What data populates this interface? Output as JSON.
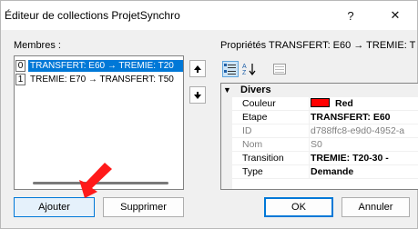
{
  "window": {
    "title": "Éditeur de collections ProjetSynchro",
    "help_glyph": "?",
    "close_glyph": "✕"
  },
  "members": {
    "label": "Membres :",
    "items": [
      {
        "index": "0",
        "text": "TRANSFERT: E60 → TREMIE: T20",
        "selected": true
      },
      {
        "index": "1",
        "text": "TREMIE: E70 → TRANSFERT: T50",
        "selected": false
      }
    ]
  },
  "properties": {
    "label": "Propriétés TRANSFERT: E60 → TREMIE: T",
    "category": "Divers",
    "rows": [
      {
        "name": "Couleur",
        "value": "Red",
        "style": "bold",
        "swatch": "#ff0000"
      },
      {
        "name": "Etape",
        "value": "TRANSFERT: E60",
        "style": "bold"
      },
      {
        "name": "ID",
        "value": "d788ffc8-e9d0-4952-a",
        "style": "dim"
      },
      {
        "name": "Nom",
        "value": "S0",
        "style": "dim"
      },
      {
        "name": "Transition",
        "value": "TREMIE: T20-30 -",
        "style": "bold"
      },
      {
        "name": "Type",
        "value": "Demande",
        "style": "bold"
      }
    ]
  },
  "buttons": {
    "add": "Ajouter",
    "remove": "Supprimer",
    "ok": "OK",
    "cancel": "Annuler"
  },
  "colors": {
    "selection": "#0078d7",
    "cursor": "#ff0000"
  }
}
